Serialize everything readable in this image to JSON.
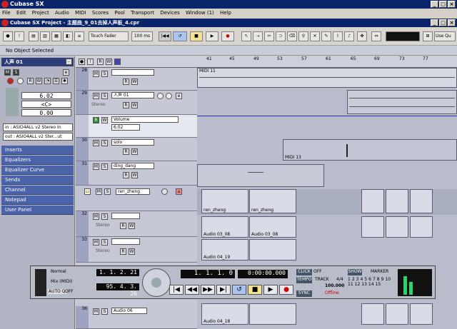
{
  "app": {
    "title": "Cubase SX",
    "project_title": "Cubase SX Project - 主题曲_9_01去掉人声板_4.cpr"
  },
  "menu": [
    "File",
    "Edit",
    "Project",
    "Audio",
    "MIDI",
    "Scores",
    "Pool",
    "Transport",
    "Devices",
    "Window (1)",
    "Help"
  ],
  "toolbar": {
    "touch_mode": "Touch Fader",
    "time": "100 ms",
    "quantize_label": "Use Qu"
  },
  "info": {
    "status": "No Object Selected"
  },
  "inspector": {
    "track_name": "人声 01",
    "volume": "6.02",
    "pan": "<C>",
    "delay": "0.00",
    "input": "in : ASIO4ALL v2 Stereo In",
    "output": "out : ASIO4ALL v2 Ster...ut",
    "sections": [
      "Inserts",
      "Equalizers",
      "Equalizer Curve",
      "Sends",
      "Channel",
      "Notepad",
      "User Panel"
    ]
  },
  "ruler": {
    "ticks": [
      "41",
      "45",
      "49",
      "53",
      "57",
      "61",
      "65",
      "69",
      "73",
      "77"
    ]
  },
  "tracks": [
    {
      "num": "28",
      "name": "",
      "sub": ""
    },
    {
      "num": "29",
      "name": "人声 01",
      "sub": "Stereo"
    },
    {
      "num": "",
      "name": "Volume",
      "sub": "6.02"
    },
    {
      "num": "30",
      "name": "solo",
      "sub": ""
    },
    {
      "num": "31",
      "name": "ding_dang",
      "sub": ""
    },
    {
      "num": "",
      "name": "ren_zheng",
      "sub": ""
    },
    {
      "num": "32",
      "name": "",
      "sub": "Stereo"
    },
    {
      "num": "33",
      "name": "",
      "sub": "Stereo"
    },
    {
      "num": "36",
      "name": "Audio 06",
      "sub": ""
    }
  ],
  "events": {
    "midi11": "MIDI 11",
    "midi13": "MIDI 13",
    "ren1": "ren_zheng",
    "ren2": "ren_zheng",
    "a0308a": "Audio 03_08",
    "a0308b": "Audio 03_08",
    "a0419": "Audio 04_19",
    "a0418": "Audio 04_18"
  },
  "transport": {
    "mode1": "Normal",
    "mode2": "Mix (MIDI)",
    "auto": "AUTO Q",
    "off": "OFF",
    "pos_left": "1. 1. 2. 21",
    "pos_right": "95. 4. 3. 26",
    "bars": "1. 1. 1.  0",
    "time": "0:00:00.000",
    "click_label": "CLICK",
    "click_val": "OFF",
    "tempo_label": "TEMPO",
    "track_label": "TRACK",
    "sig": "4/4",
    "tempo": "100.000",
    "sync_label": "SYNC",
    "sync_val": "Offline",
    "show": "SHOW",
    "marker": "MARKER",
    "marker_nums": [
      "1",
      "2",
      "3",
      "4",
      "5",
      "6",
      "7",
      "8",
      "9",
      "10",
      "11",
      "12",
      "13",
      "14",
      "15"
    ]
  }
}
